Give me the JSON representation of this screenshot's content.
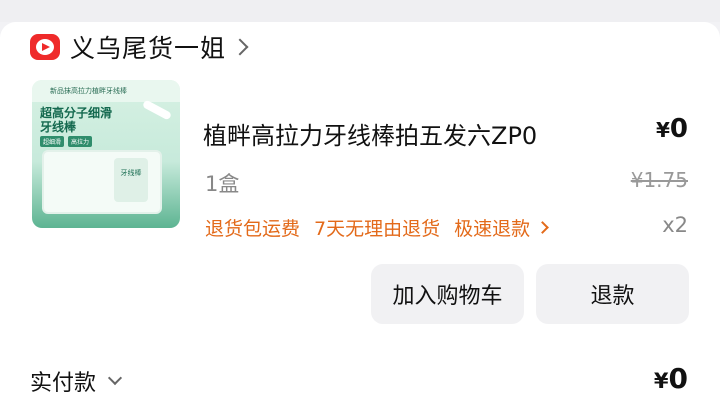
{
  "shop": {
    "name": "义乌尾货一姐",
    "logo_icon": "video-play-icon"
  },
  "product": {
    "title": "植畔高拉力牙线棒拍五发六ZP0",
    "spec": "1盒",
    "price_symbol": "¥",
    "price_value": "0",
    "original_price": "¥1.75",
    "quantity": "x2",
    "tags": [
      "退货包运费",
      "7天无理由退货",
      "极速退款"
    ],
    "thumbnail": {
      "top_text": "新品抹高拉力植畔牙线棒",
      "title_line1": "超高分子细滑",
      "title_line2": "牙线棒",
      "badges": [
        "超细滑",
        "高拉力"
      ],
      "box_label": "牙线棒"
    }
  },
  "actions": {
    "add_to_cart": "加入购物车",
    "refund": "退款"
  },
  "payment": {
    "label": "实付款",
    "symbol": "¥",
    "amount": "0"
  },
  "colors": {
    "accent_orange": "#e36a1a",
    "logo_red": "#ef2a2a"
  }
}
